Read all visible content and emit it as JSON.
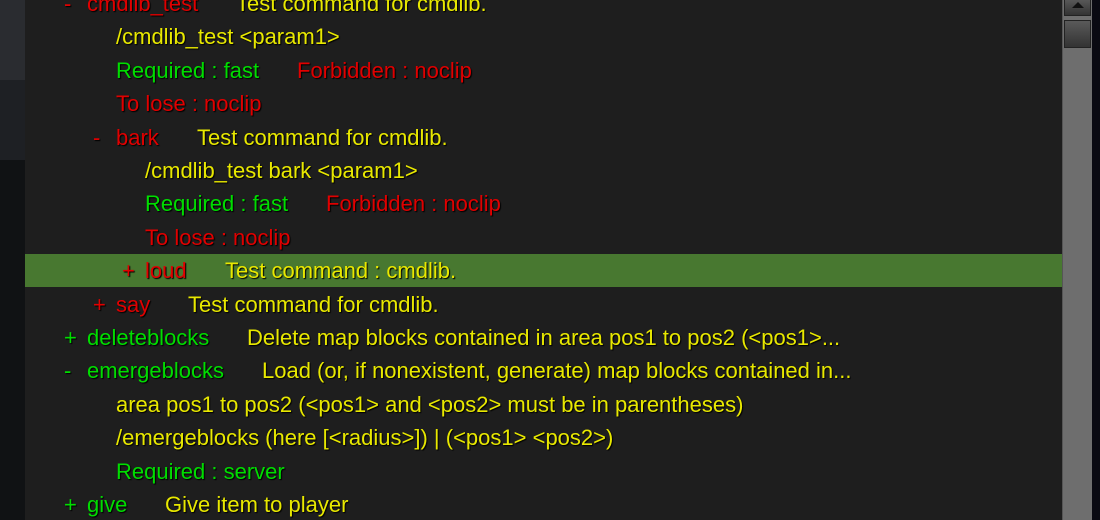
{
  "rows": [
    {
      "marker": "-",
      "name": "cmdlib_test",
      "desc": "Test command for cmdlib.",
      "level": 0,
      "color": "r"
    },
    {
      "text": "/cmdlib_test <param1>",
      "level": 0,
      "color": "y"
    },
    {
      "text": "Required : fast",
      "text2": "Forbidden : noclip",
      "level": 0,
      "color": "g",
      "color2": "r"
    },
    {
      "text": "To lose : noclip",
      "level": 0,
      "color": "r"
    },
    {
      "marker": "-",
      "name": "bark",
      "desc": "Test command for cmdlib.",
      "level": 1,
      "color": "r"
    },
    {
      "text": "/cmdlib_test bark <param1>",
      "level": 1,
      "color": "y"
    },
    {
      "text": "Required : fast",
      "text2": "Forbidden : noclip",
      "level": 1,
      "color": "g",
      "color2": "r"
    },
    {
      "text": "To lose : noclip",
      "level": 1,
      "color": "r"
    },
    {
      "marker": "+",
      "name": "loud",
      "desc": "Test command : cmdlib.",
      "level": 2,
      "color": "r",
      "selected": true
    },
    {
      "marker": "+",
      "name": "say",
      "desc": "Test command for cmdlib.",
      "level": 1,
      "color": "r"
    },
    {
      "marker": "+",
      "name": "deleteblocks",
      "desc": "Delete map blocks contained in area pos1 to pos2 (<pos1>...",
      "level": 0,
      "color": "g"
    },
    {
      "marker": "-",
      "name": "emergeblocks",
      "desc": "Load (or, if nonexistent, generate) map blocks contained in...",
      "level": 0,
      "color": "g"
    },
    {
      "text": "area pos1 to pos2 (<pos1> and <pos2> must be in parentheses)",
      "level": 0,
      "color": "y"
    },
    {
      "text": "/emergeblocks (here [<radius>]) | (<pos1> <pos2>)",
      "level": 0,
      "color": "y"
    },
    {
      "text": "Required : server",
      "level": 0,
      "color": "g"
    },
    {
      "marker": "+",
      "name": "give",
      "desc": "Give item to player",
      "level": 0,
      "color": "g"
    }
  ],
  "colors": {
    "background": "#1e1e1e",
    "selected": "#487830",
    "text": "#e8e800",
    "allowed": "#00dd00",
    "denied": "#e00000"
  },
  "scrollbar": {
    "up_icon": "triangle-up",
    "position": 0
  }
}
